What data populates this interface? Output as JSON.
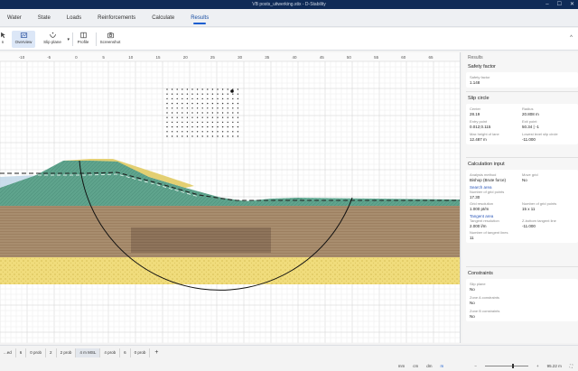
{
  "window": {
    "title": "VB posts_uitwerking.stix - D-Stability",
    "controls": [
      "–",
      "☐",
      "✕"
    ]
  },
  "menu": {
    "tabs": [
      "Water",
      "State",
      "Loads",
      "Reinforcements",
      "Calculate",
      "Results"
    ],
    "active": "Results"
  },
  "toolbar": {
    "items": [
      {
        "label": "n",
        "icon": "pointer-icon"
      },
      {
        "label": "Overview",
        "icon": "overview-icon",
        "active": true
      },
      {
        "label": "Slip plane",
        "icon": "slip-plane-icon",
        "dropdown": true
      },
      {
        "label": "Profile",
        "icon": "profile-icon"
      },
      {
        "label": "Screenshot",
        "icon": "screenshot-icon"
      }
    ],
    "collapse": "^"
  },
  "ruler": {
    "ticks": [
      "-10",
      "-5",
      "0",
      "5",
      "10",
      "15",
      "20",
      "25",
      "30",
      "35",
      "40",
      "45",
      "50",
      "55",
      "60",
      "65"
    ]
  },
  "results": {
    "header": "Results",
    "safety": {
      "title": "Safety factor",
      "label": "Safety factor",
      "value": "1.148"
    },
    "slip": {
      "title": "Slip circle",
      "center_label": "Center",
      "center": "28.19",
      "radius_label": "Radius",
      "radius": "20.808 m",
      "entry_label": "Entry point",
      "entry": "0.012;0.115",
      "exit_label": "Exit point",
      "exit": "50.34 | -1",
      "max_label": "Max height of lane",
      "max": "12.487 m",
      "lowest_label": "Lowest level slip circle",
      "lowest": "-11.000"
    },
    "calc": {
      "title": "Calculation input",
      "method_label": "Analysis method",
      "method": "Bishop (Brute force)",
      "grid_label": "Move grid",
      "grid": "No",
      "search_title": "Search area",
      "points_label": "Number of grid points",
      "points": "17.30",
      "gridres_label": "Grid resolution",
      "gridres": "1.000 pt/m",
      "ngp_label": "Number of grid points",
      "ngp": "15 x 11",
      "tangent_title": "Tangent area",
      "tres_label": "Tangent resolution",
      "tres": "2.000 l/m",
      "tbottom_label": "Z-bottom tangent line",
      "tbottom": "-11.000",
      "ntan_label": "Number of tangent lines",
      "ntan": "11"
    },
    "constraints": {
      "title": "Constraints",
      "slip_label": "Slip plane",
      "slip": "No",
      "zone1_label": "Zone A constraints",
      "zone1": "No",
      "zone2_label": "Zone B constraints",
      "zone2": "No"
    }
  },
  "stages": {
    "items": [
      "...ed",
      "6",
      "0 prob",
      "2",
      "2 prob",
      "4 m MSL",
      "4 prob",
      "6",
      "0 prob"
    ],
    "active": "4 m MSL",
    "add": "+"
  },
  "statusbar": {
    "units": [
      "mm",
      "cm",
      "dm",
      "m"
    ],
    "active_unit": "m",
    "zoom": "95.22 m"
  }
}
